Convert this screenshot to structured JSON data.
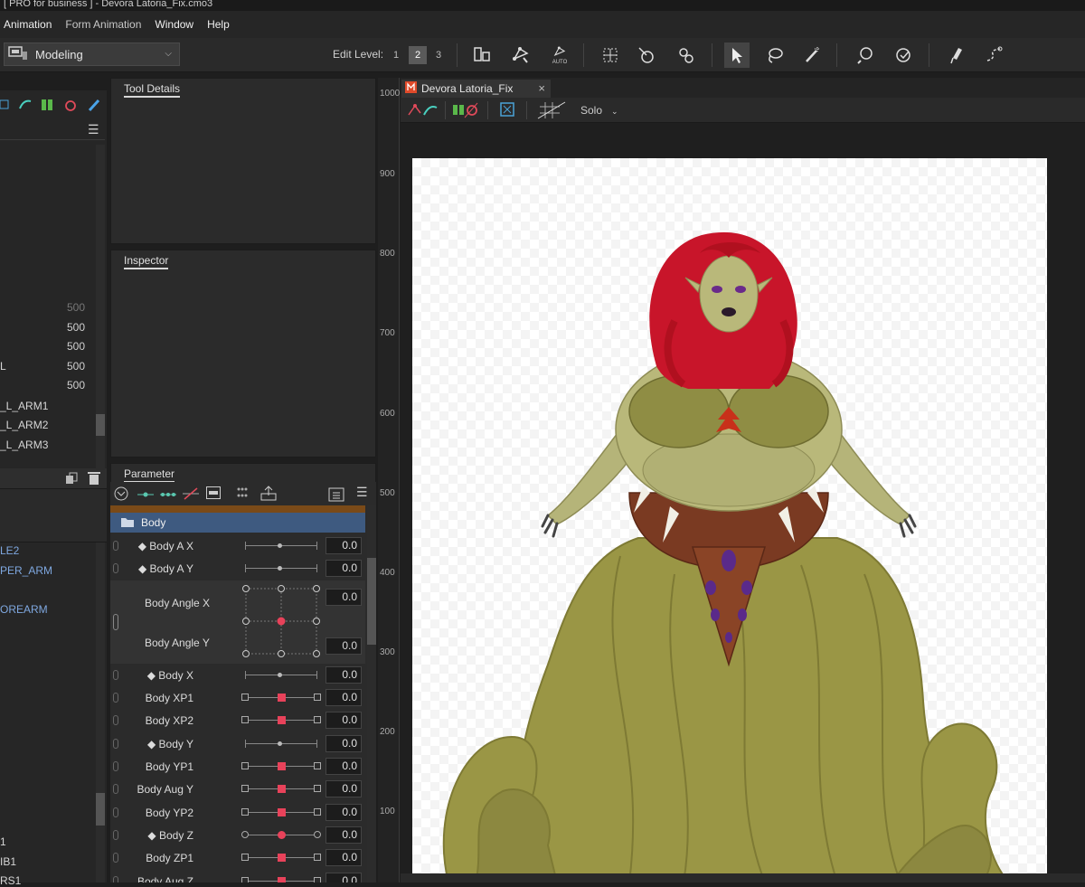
{
  "titlebar": {
    "text": "[ PRO for business ]  - Devora Latoria_Fix.cmo3"
  },
  "menu": [
    "Animation",
    "Form Animation",
    "Window",
    "Help"
  ],
  "toolbar": {
    "mode": "Modeling",
    "edit_level_label": "Edit Level:",
    "levels": [
      "1",
      "2",
      "3"
    ],
    "active_level": "2",
    "auto_label": "AUTO"
  },
  "left_panel": {
    "numbers": [
      {
        "value": "500",
        "dim": true
      },
      {
        "value": "500"
      },
      {
        "value": "500"
      },
      {
        "value": "500"
      },
      {
        "value": "500"
      }
    ],
    "l_label": "L",
    "items_top": [
      "_L_ARM1",
      "_L_ARM2",
      "_L_ARM3"
    ],
    "items_bottom": [
      "LE2",
      "PER_ARM",
      "OREARM"
    ],
    "items_footer": [
      "1",
      "IB1",
      "RS1"
    ]
  },
  "panels": {
    "tool_details": "Tool Details",
    "inspector": "Inspector",
    "parameter": "Parameter"
  },
  "parameters": {
    "group_name": "Body",
    "rows": [
      {
        "label": "◆ Body A X",
        "value": "0.0",
        "style": "dot"
      },
      {
        "label": "◆ Body A Y",
        "value": "0.0",
        "style": "dot"
      },
      {
        "label": "◆ Body X",
        "value": "0.0",
        "style": "dot"
      },
      {
        "label": "Body XP1",
        "value": "0.0",
        "style": "redsq"
      },
      {
        "label": "Body XP2",
        "value": "0.0",
        "style": "redsq"
      },
      {
        "label": "◆ Body Y",
        "value": "0.0",
        "style": "dot"
      },
      {
        "label": "Body YP1",
        "value": "0.0",
        "style": "redsq"
      },
      {
        "label": "Body Aug Y",
        "value": "0.0",
        "style": "redsq"
      },
      {
        "label": "Body YP2",
        "value": "0.0",
        "style": "redsq"
      },
      {
        "label": "◆ Body Z",
        "value": "0.0",
        "style": "redci"
      },
      {
        "label": "Body ZP1",
        "value": "0.0",
        "style": "redsq"
      },
      {
        "label": "Body Aug Z",
        "value": "0.0",
        "style": "redsq"
      }
    ],
    "angle_x": {
      "label": "Body Angle X",
      "value": "0.0"
    },
    "angle_y": {
      "label": "Body Angle Y",
      "value": "0.0"
    }
  },
  "ruler": [
    "1000",
    "900",
    "800",
    "700",
    "600",
    "500",
    "400",
    "300",
    "200",
    "100"
  ],
  "document": {
    "tab_title": "Devora Latoria_Fix",
    "close": "×",
    "solo_label": "Solo"
  },
  "colors": {
    "accent_red": "#e8425a",
    "group_blue": "#3e5a80",
    "hair_red": "#c8152a",
    "skin_green": "#b9b87a",
    "tentacle_olive": "#9a9645"
  }
}
